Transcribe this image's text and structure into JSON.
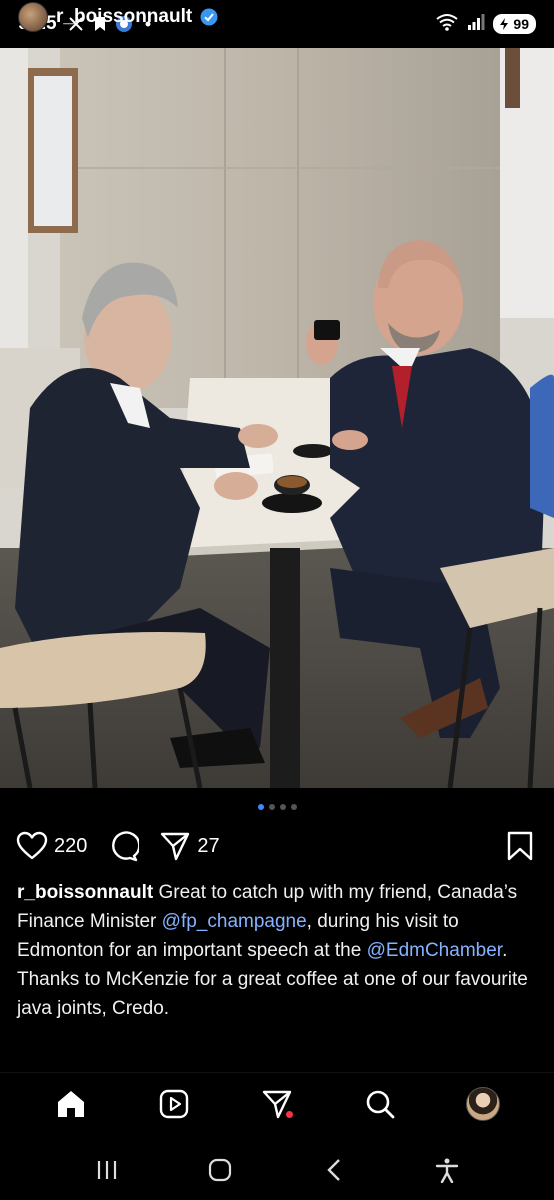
{
  "status_bar": {
    "time": "9:25",
    "battery": "99",
    "wifi_label": "6"
  },
  "post": {
    "username": "r_boissonnault",
    "verified": true,
    "carousel": {
      "count": 4,
      "active_index": 0
    }
  },
  "actions": {
    "likes": "220",
    "shares": "27"
  },
  "caption": {
    "username": "r_boissonnault",
    "segments": [
      {
        "text": " Great to catch up with my friend, Canada’s Finance Minister ",
        "type": "text"
      },
      {
        "text": "@fp_champagne",
        "type": "mention"
      },
      {
        "text": ", during his visit to Edmonton for an important speech at the ",
        "type": "text"
      },
      {
        "text": "@EdmChamber",
        "type": "mention"
      },
      {
        "text": ". Thanks to McKenzie for a great coffee at one of our favourite java joints, Credo.",
        "type": "text"
      }
    ]
  },
  "bottom_nav": {
    "items": [
      "home-icon",
      "reels-icon",
      "direct-icon",
      "search-icon",
      "profile-avatar"
    ],
    "active": "home-icon",
    "notification_color": "#ff3040"
  },
  "colors": {
    "background": "#000000",
    "mention": "#86b3ff",
    "dot_active": "#3d8bff",
    "verified": "#3897f0"
  }
}
